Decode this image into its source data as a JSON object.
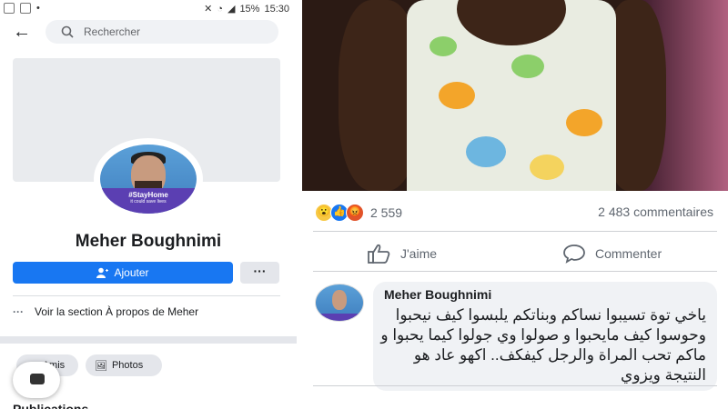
{
  "status_bar": {
    "battery": "15%",
    "time": "15:30"
  },
  "search": {
    "placeholder": "Rechercher"
  },
  "profile": {
    "name": "Meher Boughnimi",
    "frame_title": "#StayHome",
    "frame_subtitle": "it could save lives",
    "add_button": "Ajouter",
    "more_button": "···",
    "about_link": "Voir la section À propos de Meher",
    "chips": [
      "Amis",
      "Photos"
    ],
    "publications_label": "Publications"
  },
  "post": {
    "reaction_count": "2 559",
    "comments_count": "2 483 commentaires",
    "like_label": "J'aime",
    "comment_label": "Commenter",
    "reactions": [
      "wow",
      "like",
      "angry"
    ]
  },
  "comment": {
    "author": "Meher Boughnimi",
    "text": "ياخي توة تسيبوا نساكم وبناتكم يلبسوا كيف نيحبوا وحوسوا كيف مايحبوا و صولوا وي جولوا كيما يحبوا و ماكم تحب المراة والرجل كيفكف.. اكهو عاد هو النتيجة ويزوي"
  },
  "colors": {
    "accent": "#1877f2",
    "frame": "#5b3fb2"
  }
}
